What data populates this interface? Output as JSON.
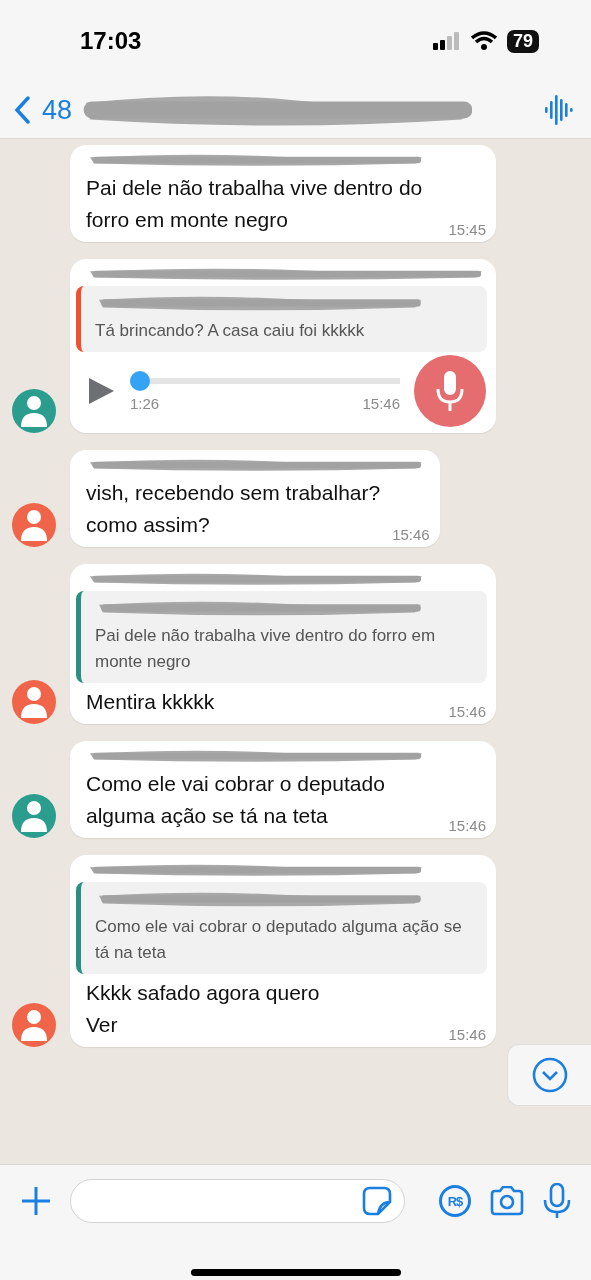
{
  "status_bar": {
    "time": "17:03",
    "battery": "79"
  },
  "header": {
    "back_count": "48",
    "title_redacted": true
  },
  "messages": [
    {
      "kind": "text",
      "sender_redacted": true,
      "text": "Pai dele não trabalha vive dentro do forro em monte negro",
      "time": "15:45"
    },
    {
      "kind": "voice",
      "avatar": {
        "color": "#2a9d8f"
      },
      "sender_redacted": true,
      "quote": {
        "color": "#f0502f",
        "author_redacted": true,
        "text": "Tá brincando? A casa caiu foi kkkkk"
      },
      "voice": {
        "level": 0.0,
        "duration": "1:26"
      },
      "time": "15:46"
    },
    {
      "kind": "text",
      "avatar": {
        "color": "#f06549"
      },
      "sender_redacted": true,
      "text": "vish, recebendo sem trabalhar?\ncomo assim?",
      "time": "15:46"
    },
    {
      "kind": "text",
      "avatar": {
        "color": "#f06549"
      },
      "sender_redacted": true,
      "quote": {
        "color": "#2a8f80",
        "author_redacted": true,
        "text": "Pai dele não trabalha vive dentro do forro em monte negro"
      },
      "text": "Mentira kkkkk",
      "time": "15:46"
    },
    {
      "kind": "text",
      "avatar": {
        "color": "#2a9d8f"
      },
      "sender_redacted": true,
      "text": "Como ele vai cobrar o deputado alguma ação se tá na teta",
      "time": "15:46"
    },
    {
      "kind": "text",
      "avatar": {
        "color": "#f06549"
      },
      "sender_redacted": true,
      "quote": {
        "color": "#2a8f80",
        "author_redacted": true,
        "text": "Como ele vai cobrar o deputado alguma ação se tá na teta"
      },
      "text": "Kkkk safado agora quero\nVer",
      "time": "15:46"
    }
  ],
  "composer": {
    "payment_label": "R$"
  }
}
